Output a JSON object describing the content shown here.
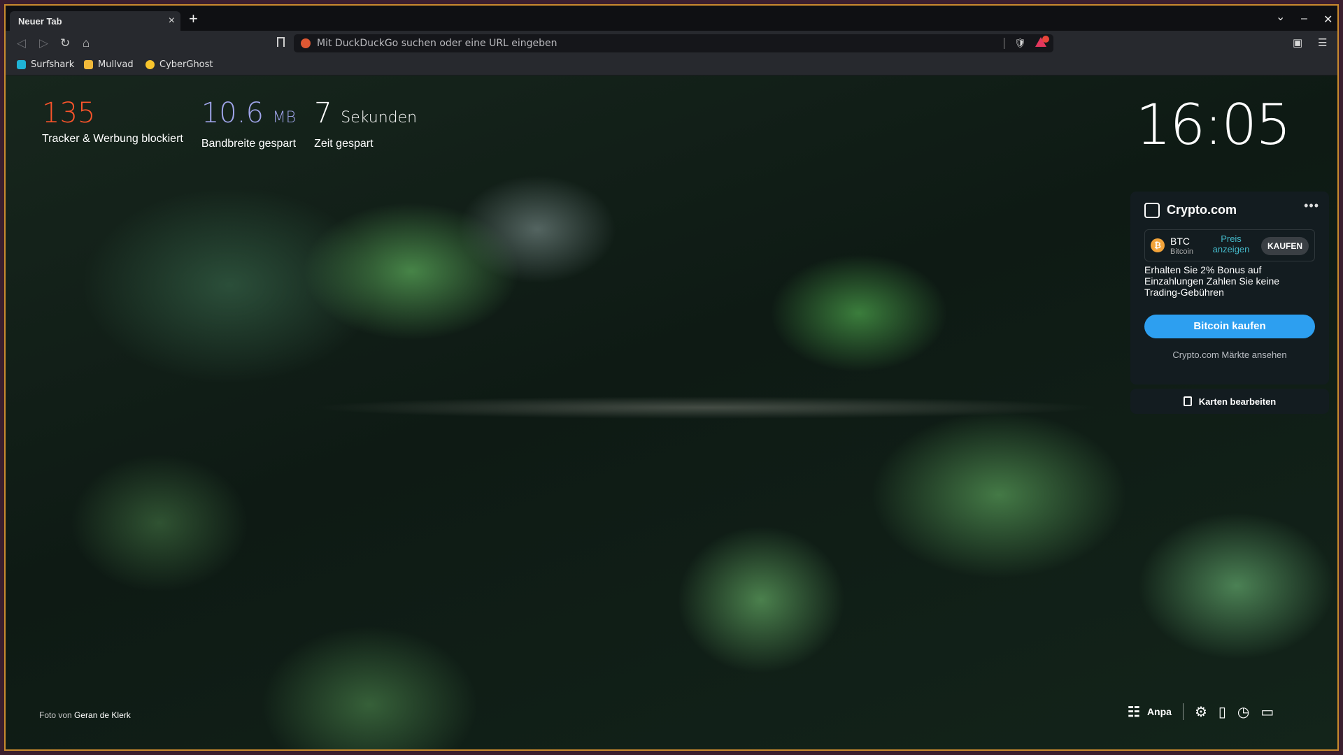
{
  "tab": {
    "title": "Neuer Tab",
    "close": "×",
    "new_tab": "+"
  },
  "window_controls": {
    "dropdown": "⌄",
    "minimize": "–",
    "close": "✕"
  },
  "toolbar": {
    "back": "◁",
    "forward": "▷",
    "reload": "↻",
    "home": "⌂",
    "url_placeholder": "Mit DuckDuckGo suchen oder eine URL eingeben",
    "shield": "🛡",
    "wallet": "▣",
    "menu": "☰"
  },
  "bookmarks": [
    {
      "label": "Surfshark",
      "icon": "surfshark-icon",
      "color": "#1fb3d6"
    },
    {
      "label": "Mullvad",
      "icon": "mullvad-icon",
      "color": "#f0b93a"
    },
    {
      "label": "CyberGhost",
      "icon": "cyberghost-icon",
      "color": "#f7c42c"
    }
  ],
  "stats": {
    "trackers": {
      "value": "135",
      "label": "Tracker & Werbung blockiert",
      "color": "#fb542b"
    },
    "bandwidth": {
      "value": "10.6",
      "unit": "MB",
      "label": "Bandbreite gespart",
      "color": "#a0a5eb"
    },
    "time": {
      "value": "7",
      "unit": "Sekunden",
      "label": "Zeit gespart"
    }
  },
  "clock": "16:05",
  "crypto_card": {
    "title": "Crypto.com",
    "more": "•••",
    "btc": {
      "symbol": "BTC",
      "name": "Bitcoin",
      "price_action": "Preis anzeigen",
      "buy_label": "KAUFEN",
      "icon_glyph": "₿"
    },
    "promo_text": "Erhalten Sie 2% Bonus auf Einzahlungen Zahlen Sie keine Trading-Gebühren",
    "cta": "Bitcoin kaufen",
    "link": "Crypto.com Märkte ansehen"
  },
  "edit_cards": "Karten bearbeiten",
  "credit": {
    "prefix": "Foto von",
    "author": "Geran de Klerk"
  },
  "bottom": {
    "customize": "Anpa",
    "customize_icon": "☷",
    "settings_icon": "⚙",
    "bookmarks_icon": "▯",
    "history_icon": "◷",
    "talk_icon": "▭"
  }
}
